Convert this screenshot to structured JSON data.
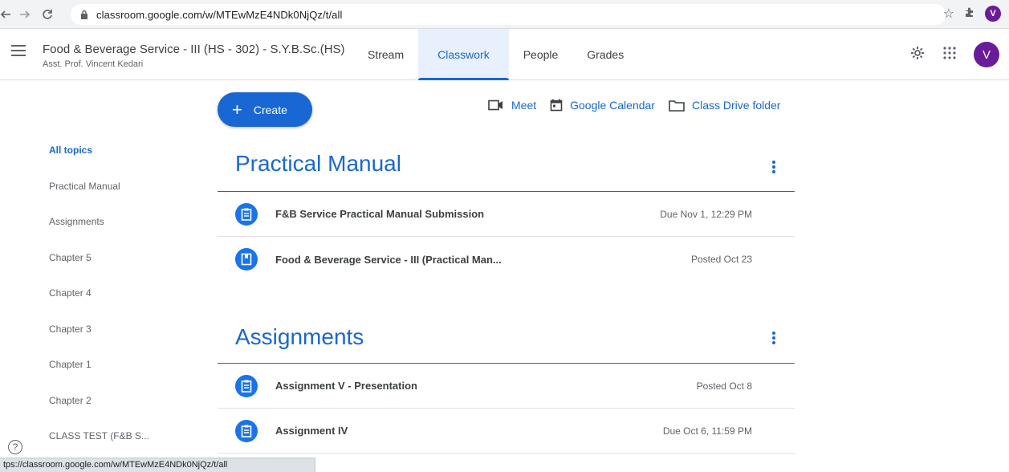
{
  "browser": {
    "url": "classroom.google.com/w/MTEwMzE4NDk0NjQz/t/all",
    "profile_initial": "V"
  },
  "header": {
    "class_title": "Food & Beverage Service - III (HS - 302) - S.Y.B.Sc.(HS)",
    "teacher": "Asst. Prof. Vincent Kedari",
    "tabs": [
      {
        "label": "Stream"
      },
      {
        "label": "Classwork"
      },
      {
        "label": "People"
      },
      {
        "label": "Grades"
      }
    ],
    "active_tab": "Classwork",
    "avatar_initial": "V"
  },
  "toolbar": {
    "create_label": "Create",
    "meet_label": "Meet",
    "calendar_label": "Google Calendar",
    "drive_label": "Class Drive folder"
  },
  "topics": {
    "items": [
      "All topics",
      "Practical Manual",
      "Assignments",
      "Chapter 5",
      "Chapter 4",
      "Chapter 3",
      "Chapter 1",
      "Chapter 2",
      "CLASS TEST (F&B S..."
    ]
  },
  "sections": [
    {
      "title": "Practical Manual",
      "items": [
        {
          "title": "F&B Service Practical Manual Submission",
          "meta": "Due Nov 1, 12:29 PM",
          "icon": "assignment-icon"
        },
        {
          "title": "Food & Beverage Service - III (Practical Man...",
          "meta": "Posted Oct 23",
          "icon": "material-icon"
        }
      ]
    },
    {
      "title": "Assignments",
      "items": [
        {
          "title": "Assignment V - Presentation",
          "meta": "Posted Oct 8",
          "icon": "assignment-icon"
        },
        {
          "title": "Assignment IV",
          "meta": "Due Oct 6, 11:59 PM",
          "icon": "assignment-icon"
        }
      ]
    }
  ],
  "status_bar": {
    "url": "tps://classroom.google.com/w/MTEwMzE4NDk0NjQz/t/all"
  },
  "colors": {
    "accent": "#1967d2",
    "avatar": "#6a1b9a"
  }
}
